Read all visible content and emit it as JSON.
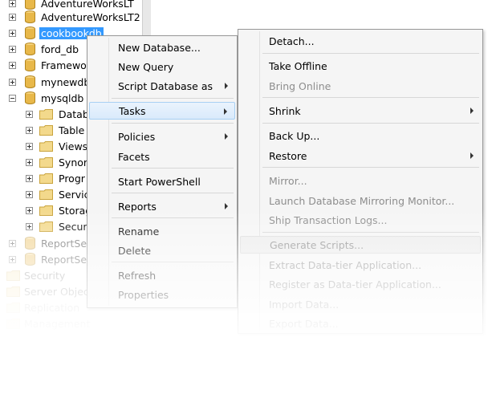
{
  "tree": {
    "databases": [
      {
        "label": "AdventureWorksLT"
      },
      {
        "label": "AdventureWorksLT2"
      },
      {
        "label": "cookbookdb"
      },
      {
        "label": "ford_db"
      },
      {
        "label": "Framewo"
      },
      {
        "label": "mynewdb"
      },
      {
        "label": "mysqldb"
      }
    ],
    "folders": [
      {
        "label": "Datab"
      },
      {
        "label": "Table"
      },
      {
        "label": "Views"
      },
      {
        "label": "Synor"
      },
      {
        "label": "Progr"
      },
      {
        "label": "Servic"
      },
      {
        "label": "Storag"
      },
      {
        "label": "Secur"
      }
    ],
    "report_servers": [
      {
        "label": "ReportSer"
      },
      {
        "label": "ReportSer"
      }
    ],
    "root_nodes": [
      {
        "label": "Security"
      },
      {
        "label": "Server Object"
      },
      {
        "label": "Replication"
      },
      {
        "label": "Management"
      }
    ]
  },
  "context_menu": {
    "items": {
      "new_database": "New Database...",
      "new_query": "New Query",
      "script_database_as": "Script Database as",
      "tasks": "Tasks",
      "policies": "Policies",
      "facets": "Facets",
      "start_powershell": "Start PowerShell",
      "reports": "Reports",
      "rename": "Rename",
      "delete": "Delete",
      "refresh": "Refresh",
      "properties": "Properties"
    }
  },
  "tasks_submenu": {
    "items": {
      "detach": "Detach...",
      "take_offline": "Take Offline",
      "bring_online": "Bring Online",
      "shrink": "Shrink",
      "back_up": "Back Up...",
      "restore": "Restore",
      "mirror": "Mirror...",
      "launch_mirroring_monitor": "Launch Database Mirroring Monitor...",
      "ship_transaction_logs": "Ship Transaction Logs...",
      "generate_scripts": "Generate Scripts...",
      "extract_data_tier": "Extract Data-tier Application...",
      "register_data_tier": "Register as Data-tier Application...",
      "import_data": "Import Data...",
      "export_data": "Export Data..."
    }
  },
  "colors": {
    "selection": "#3399ff",
    "menu_bg": "#f5f5f5",
    "highlight": "#d9eafb",
    "disabled_text": "#8d8d8d",
    "db_icon": "#e8b84a"
  }
}
